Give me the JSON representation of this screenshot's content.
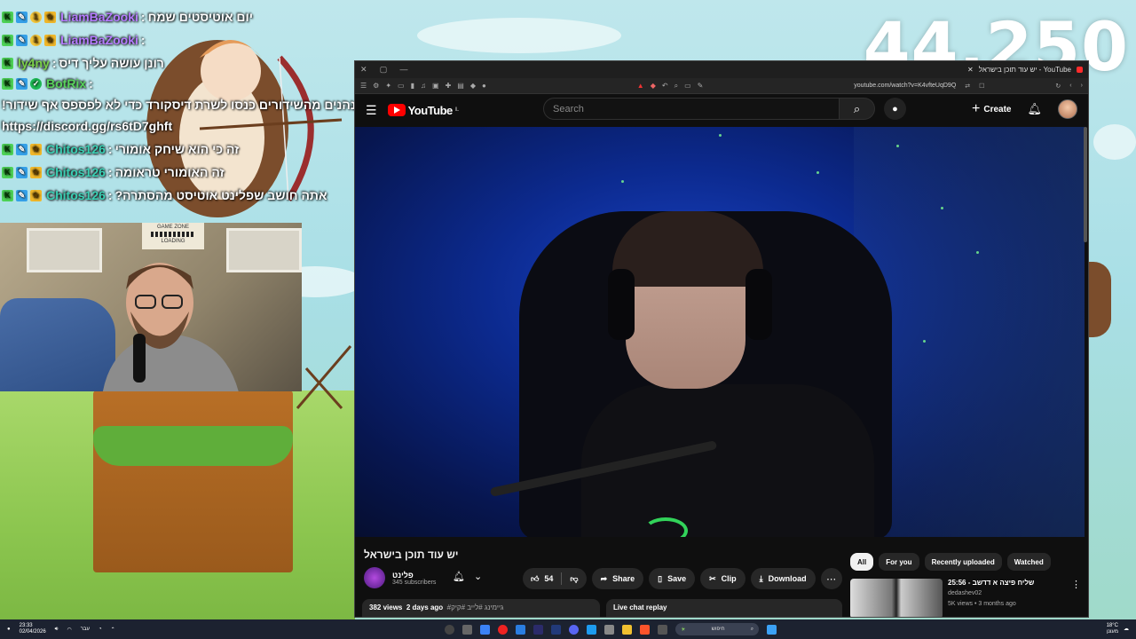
{
  "counter": "44,250",
  "chat": [
    {
      "badges": [
        "k",
        "w",
        "c",
        "s"
      ],
      "user": "LiamBaZooki",
      "sep": ":",
      "text": "יום אוטיסטים שמח",
      "color": "u-liam"
    },
    {
      "badges": [
        "k",
        "w",
        "c",
        "s"
      ],
      "user": "LiamBaZooki",
      "sep": ":",
      "text": "",
      "color": "u-liam"
    },
    {
      "badges": [
        "k"
      ],
      "user": "ly4ny",
      "sep": ":",
      "text": "רונן עושה עליך דיס",
      "color": "u-ly"
    },
    {
      "badges": [
        "k",
        "w",
        "v"
      ],
      "user": "BotRix",
      "sep": ":",
      "text": "אם אתם נהנים מהשידורים כנסו לשרת דיסקורד כדי לא לפספס אף שידור!",
      "link": "https://discord.gg/rs6tD7ghft",
      "color": "u-bot"
    },
    {
      "badges": [
        "k",
        "w",
        "s"
      ],
      "user": "Chitos126",
      "sep": ":",
      "text": "זה כי הוא שיחק אומורי",
      "color": "u-chit"
    },
    {
      "badges": [
        "k",
        "w",
        "s"
      ],
      "user": "Chitos126",
      "sep": ":",
      "text": "זה האומורי טראומה",
      "color": "u-chit"
    },
    {
      "badges": [
        "k",
        "w",
        "s"
      ],
      "user": "Chitos126",
      "sep": ":",
      "text": "אתה חושב שפלינט אוטיסט מהסתרה?",
      "color": "u-chit"
    }
  ],
  "webcam": {
    "sign_line1": "GAME ZONE",
    "sign_line2": "LOADING"
  },
  "browser": {
    "tab_title": "יש עוד תוכן בישראל - YouTube",
    "url": "youtube.com/watch?v=K4vfteUqD9Q"
  },
  "youtube": {
    "logo": "YouTube",
    "region": "IL",
    "search_placeholder": "Search",
    "create_label": "Create",
    "video_title": "יש עוד תוכן בישראל",
    "channel_name": "פלינט",
    "subscribers": "345 subscribers",
    "likes": "54",
    "share": "Share",
    "save": "Save",
    "clip": "Clip",
    "download": "Download",
    "views": "382 views",
    "date": "2 days ago",
    "tags": "#גיימינג #לייב #קיק",
    "live_chat": "Live chat replay",
    "chips": [
      "All",
      "For you",
      "Recently uploaded",
      "Watched"
    ],
    "rec": {
      "title": "שליח פיצה א דדשב - 25:56",
      "channel": "dedashev02",
      "meta": "5K views • 3 months ago"
    }
  },
  "taskbar": {
    "time": "23:33",
    "date": "02/04/2026",
    "lang": "עבר",
    "search": "חיפוש",
    "weather": "18°C",
    "weather_desc": "מעונן"
  }
}
